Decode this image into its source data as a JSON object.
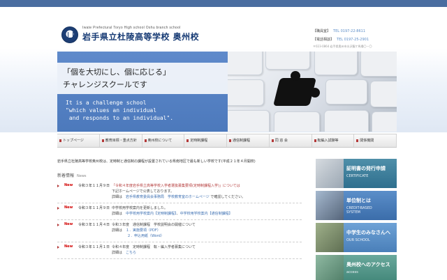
{
  "header": {
    "school_en": "Iwate Prefectural Toryo High school Oshu branch school",
    "school_jp": "岩手県立杜陵高等学校 奥州校",
    "contact": [
      {
        "label": "【職員室】",
        "number": "TEL 0197-22-8611"
      },
      {
        "label": "【電話相談】",
        "number": "TEL 0197-25-2901"
      }
    ],
    "address": "〒023-0864 岩手県奥州市水沢龍ケ馬場〇－〇"
  },
  "hero": {
    "jp_line1": "「個を大切にし、個に応じる」",
    "jp_line2": "チャレンジスクールです",
    "en_text": "It is a challenge school\n\"which values an individual\n and responds to an individual\"."
  },
  "nav": {
    "items": [
      {
        "label": "トップページ"
      },
      {
        "label": "教育目標・重点方針"
      },
      {
        "label": "奥州校について"
      },
      {
        "label": "定時制課程"
      },
      {
        "label": "通信制課程"
      },
      {
        "label": "同 窓 会"
      },
      {
        "label": "転編入試験等"
      },
      {
        "label": "関係機関"
      }
    ]
  },
  "main": {
    "intro": "岩手県立杜陵高等学校奥州校は、定時制と通信制の課程が設置されている県南地区で最も新しい学校です(平成２１年４月開校)",
    "news_title": "新着情報",
    "news_title_en": "News",
    "news": [
      {
        "new": "New",
        "date": "令和３年１１月９日",
        "line1": "「令和４年度岩手県立高等学校入学者選抜募集要項(定時制課程入学)」については",
        "line2": "下記ホームページで公表しております。",
        "line3_prefix": "詳細は",
        "line3_link": "岩手県教育委員会事務局　学校教育室のホームページ",
        "line3_suffix": "で確認してください。"
      },
      {
        "new": "New",
        "date": "令和３年１１月９日",
        "line1": "中学校用学校案内を更新しました。",
        "line2_prefix": "詳細は",
        "line2_link": "中学校用学校案内【定時制課程】",
        "line2_link2": "中学校用学校案内【通信制課程】"
      },
      {
        "new": "New",
        "date": "令和３年１１月４日",
        "line1": "令和３年度　通信制課程　学校説明会の開催について",
        "line2_prefix": "詳細は",
        "line2_link": "１．実施要項（PDF）",
        "line3_link": "２．申込用紙（Word）"
      },
      {
        "new": "New",
        "date": "令和３年１１月１日",
        "line1": "令和４年度　定時制課程　転・編入学者募集について",
        "line2_prefix": "詳細は",
        "line2_link": "こちら"
      }
    ]
  },
  "sidebar": {
    "banners": [
      {
        "title": "証明書の発行申請",
        "sub": "CERTIFICATE"
      },
      {
        "title": "単位制とは",
        "sub": "CREDIT-BASED\nSYSTEM"
      },
      {
        "title": "中学生のみなさんへ",
        "sub": "OUR SCHOOL"
      },
      {
        "title": "奥州校へのアクセス",
        "sub": "access"
      }
    ]
  }
}
